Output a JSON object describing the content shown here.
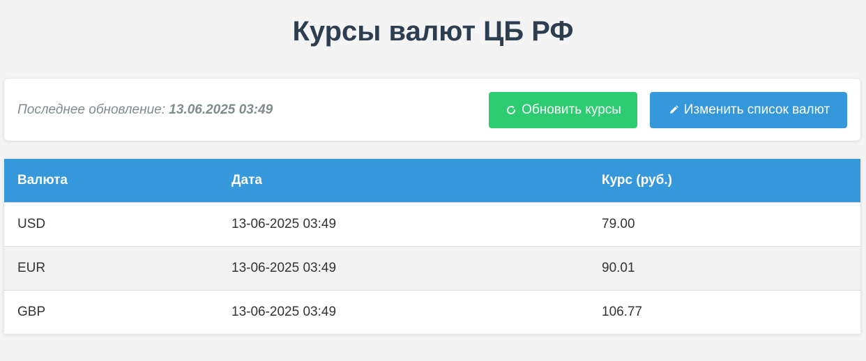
{
  "page": {
    "title": "Курсы валют ЦБ РФ"
  },
  "toolbar": {
    "update_label": "Последнее обновление:",
    "update_value": "13.06.2025 03:49",
    "refresh_button": {
      "label": "Обновить курсы",
      "icon": "refresh-icon",
      "color": "#2ecc71"
    },
    "edit_button": {
      "label": "Изменить список валют",
      "icon": "pencil-icon",
      "color": "#3498db"
    }
  },
  "table": {
    "header_color": "#3498db",
    "columns": [
      "Валюта",
      "Дата",
      "Курс (руб.)"
    ],
    "rows": [
      [
        "USD",
        "13-06-2025 03:49",
        "79.00"
      ],
      [
        "EUR",
        "13-06-2025 03:49",
        "90.01"
      ],
      [
        "GBP",
        "13-06-2025 03:49",
        "106.77"
      ]
    ]
  }
}
